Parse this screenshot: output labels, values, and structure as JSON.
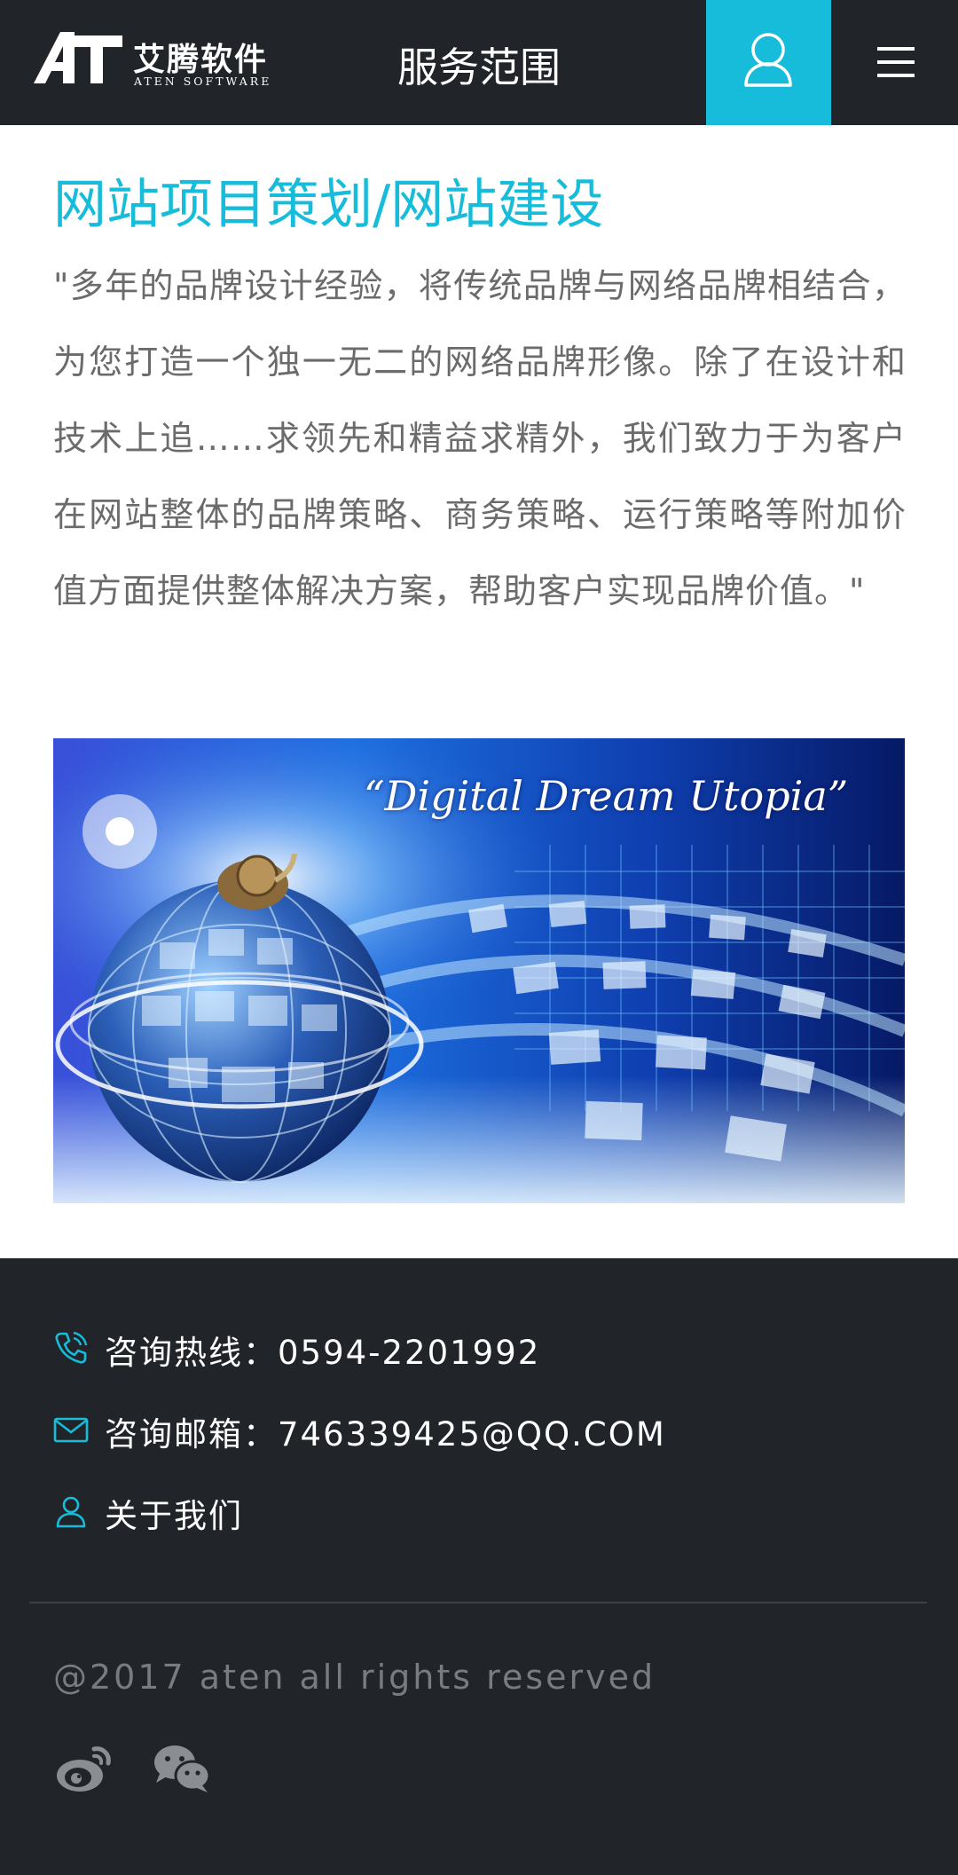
{
  "header": {
    "logo_cn": "艾腾软件",
    "logo_en": "ATEN SOFTWARE",
    "nav_title": "服务范围",
    "accent_color": "#16bcd9",
    "background_color": "#212429",
    "user_icon": "user-icon",
    "menu_icon": "hamburger-menu-icon"
  },
  "main": {
    "title": "网站项目策划/网站建设",
    "description": "\"多年的品牌设计经验，将传统品牌与网络品牌相结合，为您打造一个独一无二的网络品牌形像。除了在设计和技术上追……求领先和精益求精外，我们致力于为客户在网站整体的品牌策略、商务策略、运行策略等附加价值方面提供整体解决方案，帮助客户实现品牌价值。\"",
    "banner": {
      "caption": "“Digital Dream Utopia”"
    }
  },
  "footer": {
    "hotline": "咨询热线：0594-2201992",
    "email": "咨询邮箱：746339425@QQ.COM",
    "about": "关于我们",
    "copyright": "@2017 aten all rights reserved",
    "social": [
      "weibo-icon",
      "wechat-icon"
    ]
  }
}
